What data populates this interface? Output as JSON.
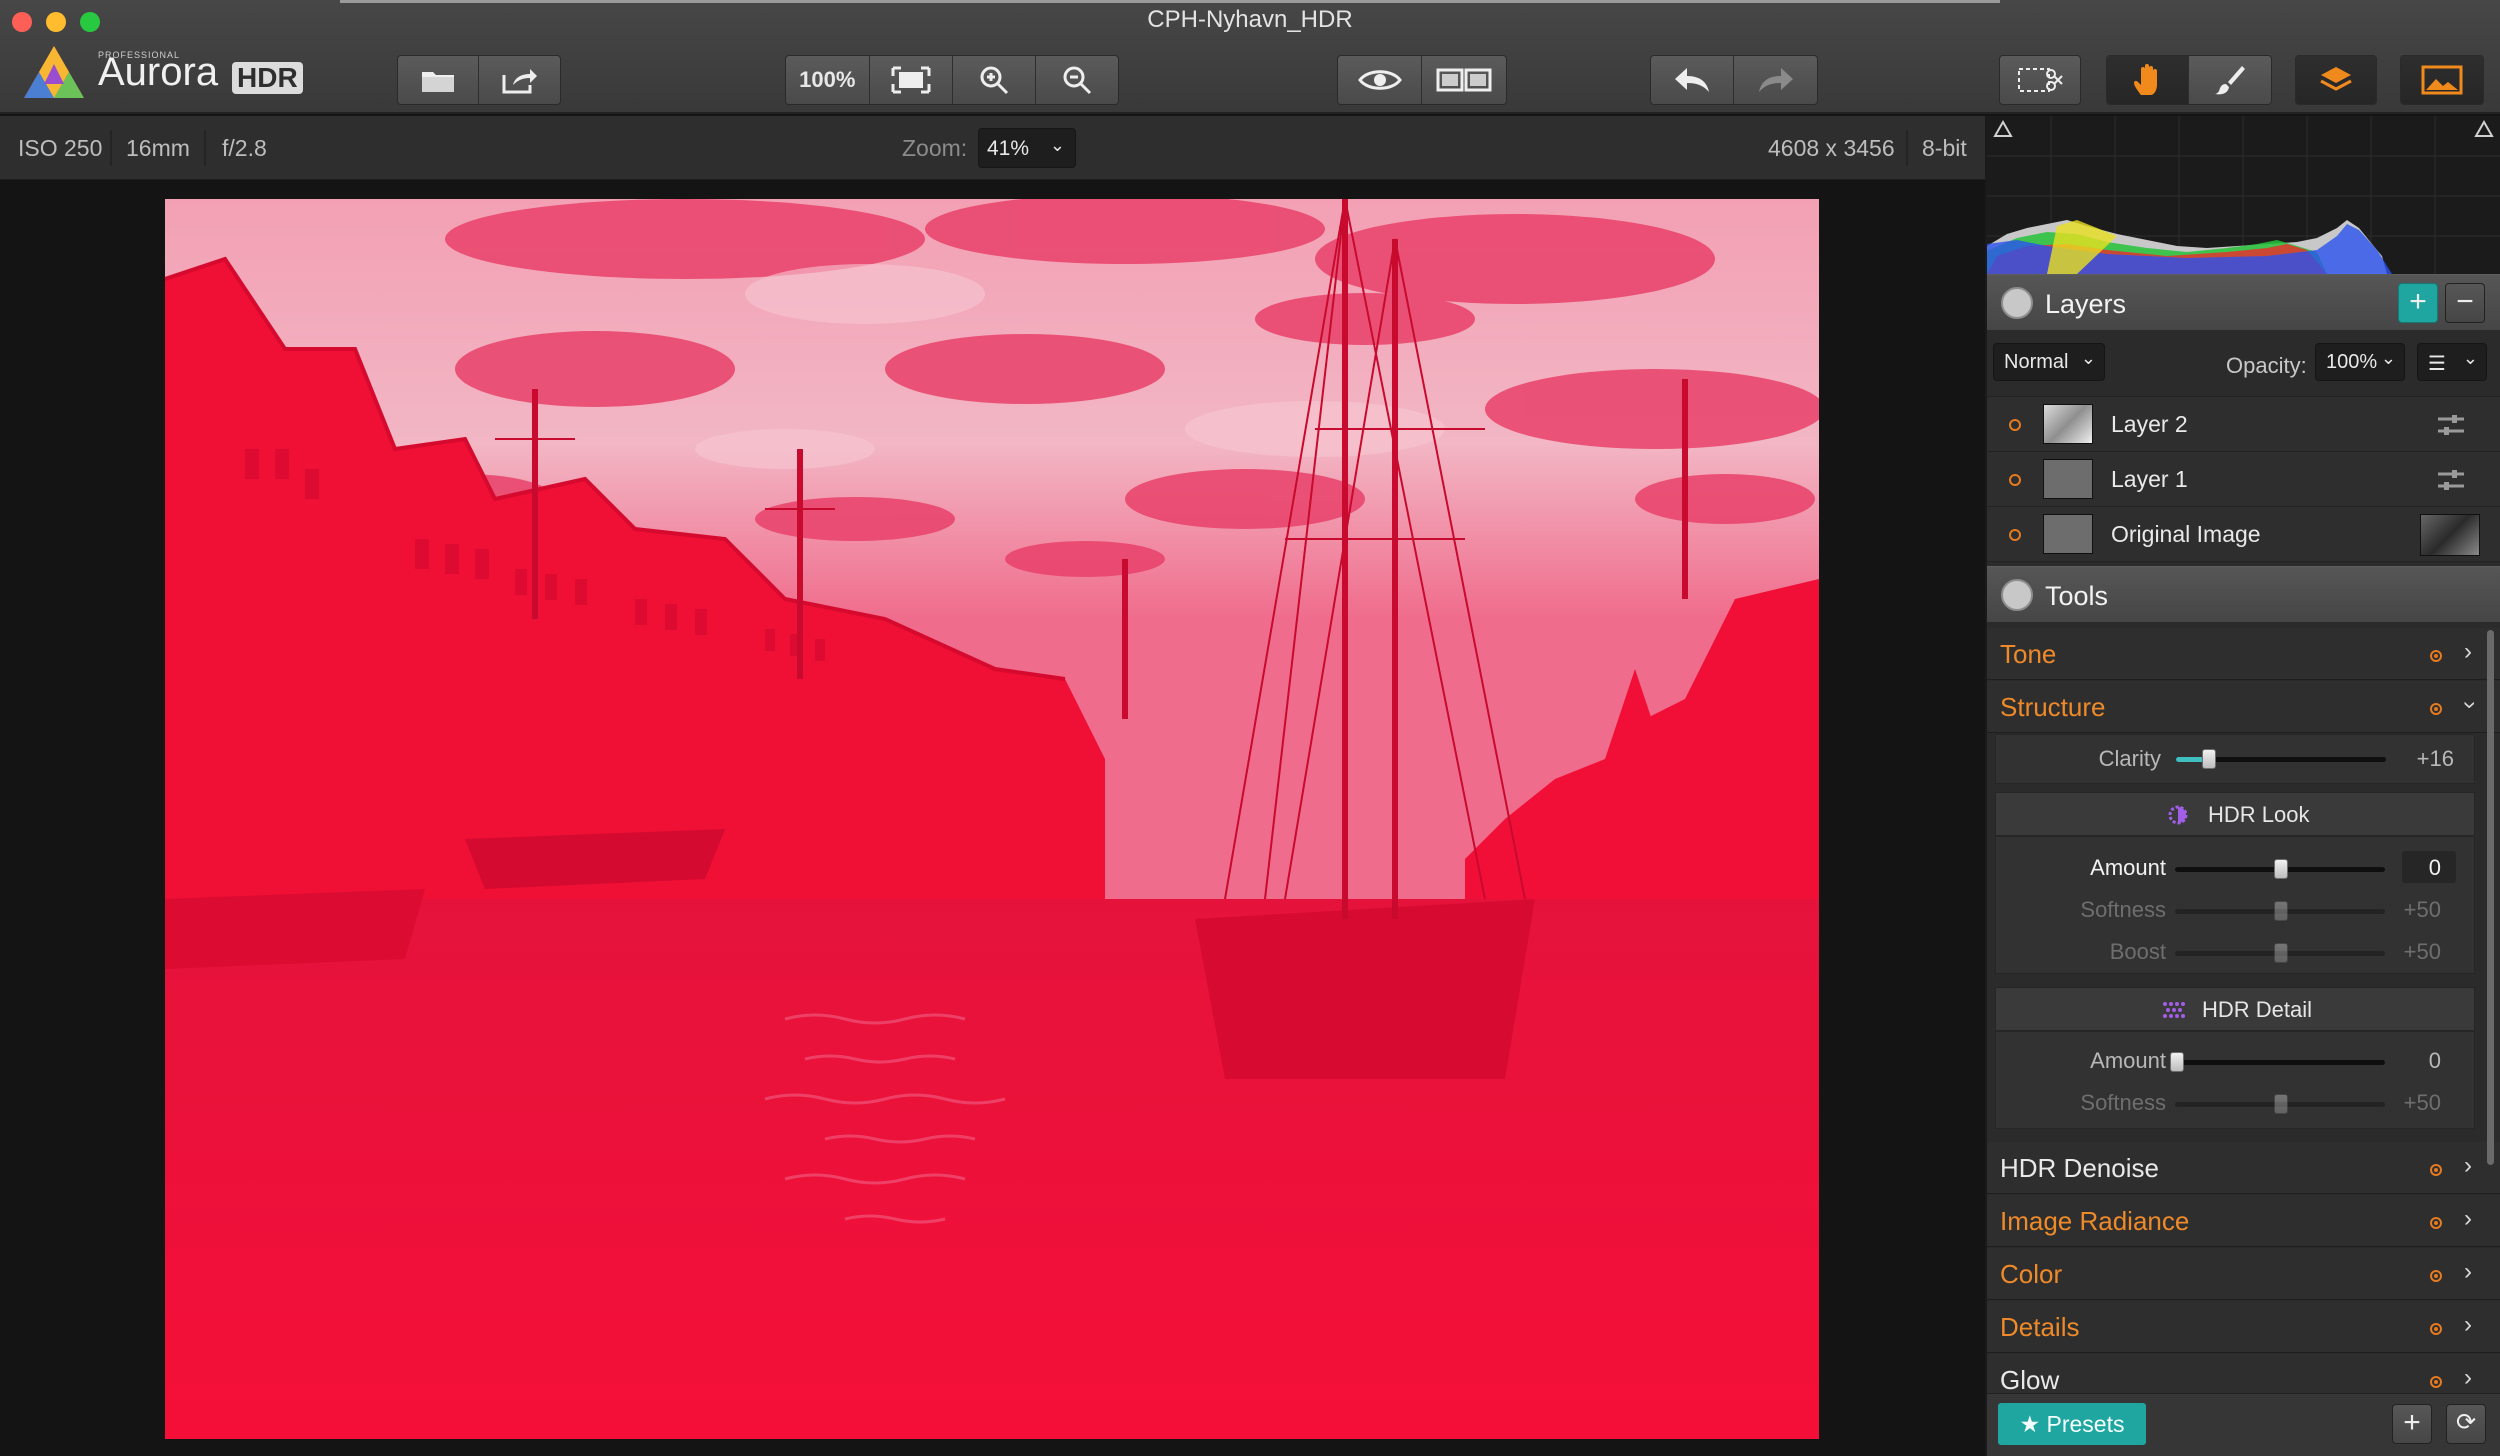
{
  "window": {
    "title": "CPH-Nyhavn_HDR",
    "traffic_colors": [
      "#fd5f57",
      "#febc2e",
      "#28c840"
    ]
  },
  "app": {
    "logo_small": "PROFESSIONAL",
    "logo_name": "Aurora",
    "logo_badge": "HDR"
  },
  "toolbar": {
    "zoom_100_label": "100%",
    "icons": [
      "open-folder-icon",
      "share-icon",
      "fit-screen-icon",
      "zoom-in-icon",
      "zoom-out-icon",
      "eye-icon",
      "compare-icon",
      "undo-icon",
      "redo-icon",
      "crop-transform-icon",
      "hand-icon",
      "brush-icon",
      "layers-icon",
      "image-panel-icon"
    ]
  },
  "info": {
    "iso": "ISO 250",
    "focal": "16mm",
    "aperture": "f/2.8",
    "zoom_label": "Zoom:",
    "zoom_value": "41%",
    "dimensions": "4608 x 3456",
    "bit_depth": "8-bit"
  },
  "layers": {
    "title": "Layers",
    "blend_mode": "Normal",
    "opacity_label": "Opacity:",
    "opacity_value": "100%",
    "items": [
      {
        "name": "Layer 2"
      },
      {
        "name": "Layer 1"
      },
      {
        "name": "Original Image"
      }
    ]
  },
  "tools": {
    "title": "Tools",
    "items": [
      "Tone",
      "Structure",
      "HDR Denoise",
      "Image Radiance",
      "Color",
      "Details",
      "Glow"
    ],
    "structure": {
      "clarity_label": "Clarity",
      "clarity_value": "+16",
      "clarity_level": 0.16
    },
    "hdr_look": {
      "title": "HDR Look",
      "amount_label": "Amount",
      "amount_value": "0",
      "softness_label": "Softness",
      "softness_value": "+50",
      "boost_label": "Boost",
      "boost_value": "+50"
    },
    "hdr_detail": {
      "title": "HDR Detail",
      "amount_label": "Amount",
      "amount_value": "0",
      "softness_label": "Softness",
      "softness_value": "+50"
    }
  },
  "presets": {
    "label": "Presets"
  },
  "colors": {
    "accent_orange": "#ef8a2a",
    "accent_teal": "#1fa6a1",
    "overlay_red": "#f0103a"
  }
}
